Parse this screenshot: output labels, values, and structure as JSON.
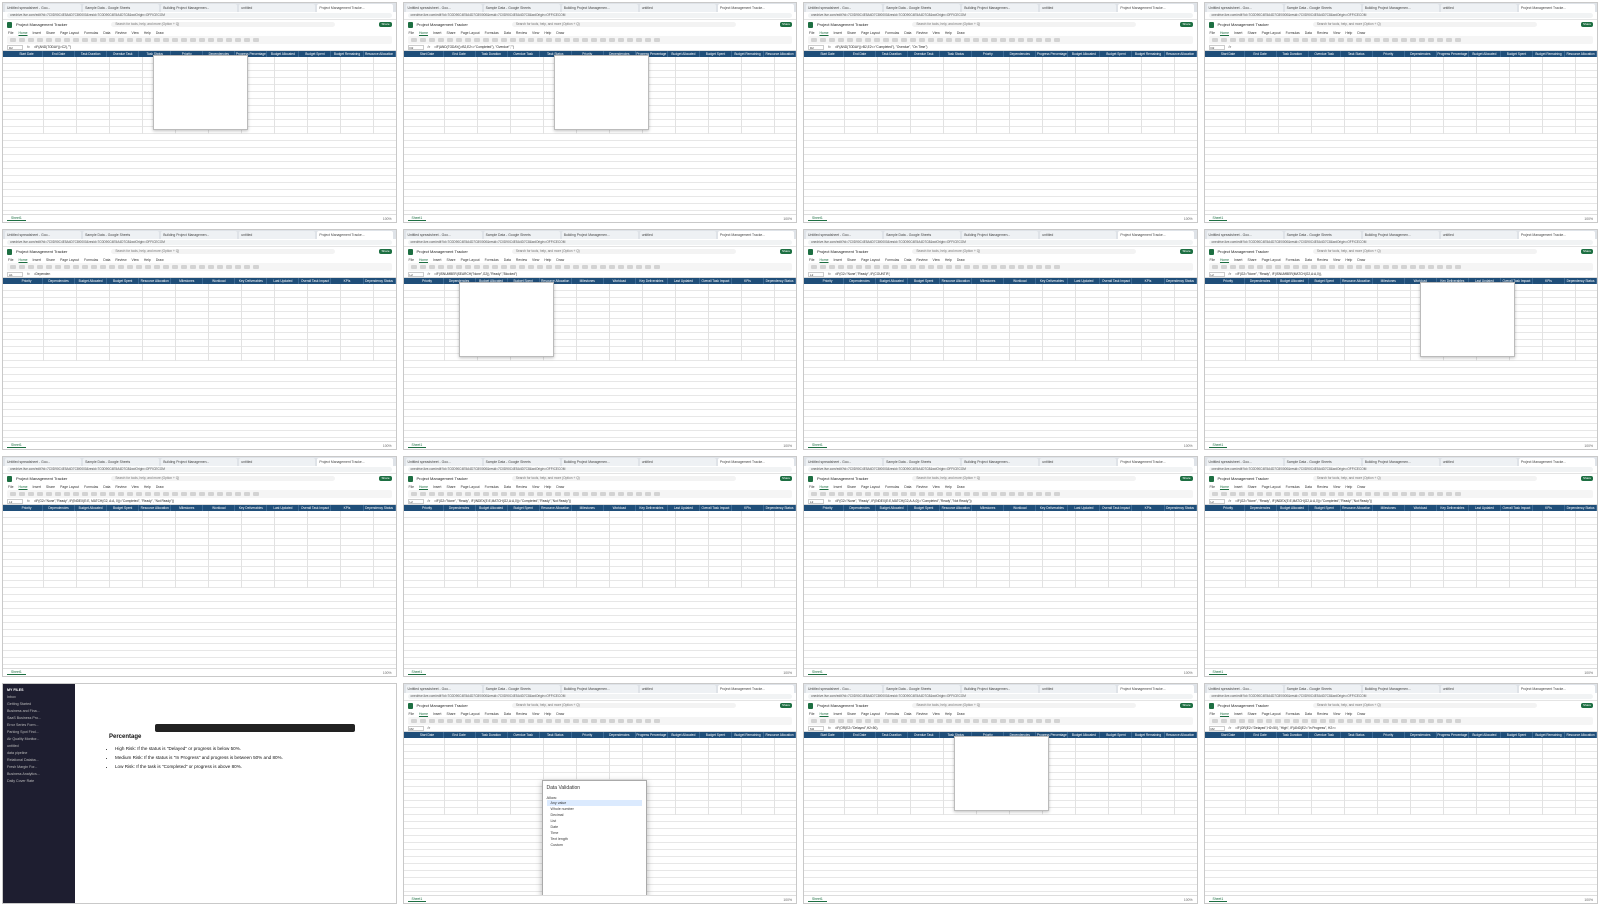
{
  "browser": {
    "tabs": [
      "Untitled spreadsheet - Goo...",
      "Sample Data - Google Sheets",
      "Building Project Managemen...",
      "untitled",
      "Project Management Tracke..."
    ],
    "url": "onedrive.live.com/edit?id=7C0D90C4E5A4D7C8!0000&resid=7C0D90C4E5A4D7C8&wdOrigin=OFFICECOM"
  },
  "app": {
    "doc_title": "Project Management Tracker",
    "search_placeholder": "Search for tools, help, and more (Option + Q)",
    "menu": [
      "File",
      "Home",
      "Insert",
      "Share",
      "Page Layout",
      "Formulas",
      "Data",
      "Review",
      "View",
      "Help",
      "Draw"
    ],
    "share_label": "Share",
    "sheet_tab": "Sheet1",
    "zoom": "100%"
  },
  "columns_a": [
    "Start Date",
    "End Date",
    "Task Duration",
    "Overdue Task",
    "Task Status",
    "Priority",
    "Dependencies",
    "Progress Percentage",
    "Budget Allocated",
    "Budget Spent",
    "Budget Remaining",
    "Resource Allocation"
  ],
  "columns_b": [
    "Priority",
    "Dependencies",
    "Budget Allocated",
    "Budget Spent",
    "Resource Allocation",
    "Milestones",
    "Workload",
    "Key Deliverables",
    "Last Updated",
    "Overall Task Impact",
    "KPIs",
    "Dependency Status"
  ],
  "tiles": [
    {
      "cell": "D2",
      "formula": "=IF(AND(TODAY()>C2),\"\")"
    },
    {
      "cell": "D2",
      "formula": "=IF(AND(TODAY()>B2,E2<>\"Completed\"), \"Overdue\",\"\")"
    },
    {
      "cell": "D2",
      "formula": "=IF(AND(TODAY()>B2,E2<>\"Completed\"), \"Overdue\", \"On Time\")"
    },
    {
      "cell": "D2",
      "formula": ""
    },
    {
      "cell": "A1",
      "formula": "=Dependen"
    },
    {
      "cell": "L2",
      "formula": "=IF(ISNUMBER(SEARCH(\"None\",G2)),\"Ready\",\"Blocked\")"
    },
    {
      "cell": "L2",
      "formula": "=IF(G2=\"None\",\"Ready\", IF(COUNTIF("
    },
    {
      "cell": "L2",
      "formula": "=IF(G2=\"None\", \"Ready\", IF(ISNUMBER(MATCH(G2,A:A,0)),"
    },
    {
      "cell": "L2",
      "formula": "=IF(G2=\"None\",\"Ready\", IF(INDEX(E:E, MATCH(G2, A:A, 0))=\"Completed\", \"Ready\", \"Not Ready\"))"
    },
    {
      "cell": "L2",
      "formula": "=IF(G2=\"None\", \"Ready\", IF(INDEX(E:E,MATCH(G2,A:A,0))=\"Completed\",\"Ready\",\"Not Ready\"))"
    },
    {
      "cell": "L2",
      "formula": "=IF(G2=\"None\", \"Ready\", IF(INDEX(E:E,MATCH(G2,A:A,0))=\"Completed\",\"Ready\",\"Not Ready\"))"
    },
    {
      "cell": "L2",
      "formula": "=IF(G2=\"None\", \"Ready\", IF(INDEX(E:E,MATCH(G2,A:A,0))=\"Completed\",\"Ready\",\"Not Ready\"))"
    },
    {
      "cell": "",
      "formula": ""
    },
    {
      "cell": "M2",
      "formula": ""
    },
    {
      "cell": "M2",
      "formula": "=IF(OR(E2=\"Delayed\",H2<50),"
    },
    {
      "cell": "M2",
      "formula": "=IF(OR(E2=\"Delayed\",H2<50), \"High\", IF(AND(E2=\"In Progress\", H2>="
    }
  ],
  "note": {
    "sidebar_header": "MY FILES",
    "sidebar_items": [
      "Inbox",
      "Getting Started",
      "Business and Fina...",
      "SaaS Business Pro...",
      "Error Series Form...",
      "Parking Spot Find...",
      "Air Quality Monitor...",
      "untitled",
      "data pipeline",
      "Relational Databa...",
      "Fresh Margin For...",
      "Business Analytics...",
      "Daily Cover Rate"
    ],
    "heading": "Percentage",
    "bullets": [
      "High Risk: If the status is \"Delayed\" or progress is below 50%.",
      "Medium Risk: If the status is \"In Progress\" and progress is between 50% and 80%.",
      "Low Risk: If the task is \"Completed\" or progress is above 80%."
    ]
  },
  "data_validation": {
    "title": "Data Validation",
    "tabs": [
      "Settings",
      "Input Message",
      "Error Alert"
    ],
    "label": "Allow:",
    "options": [
      "Any value",
      "Whole number",
      "Decimal",
      "List",
      "Date",
      "Time",
      "Text length",
      "Custom"
    ],
    "clear": "Clear All",
    "apply": "Apply",
    "cancel": "Cancel"
  }
}
